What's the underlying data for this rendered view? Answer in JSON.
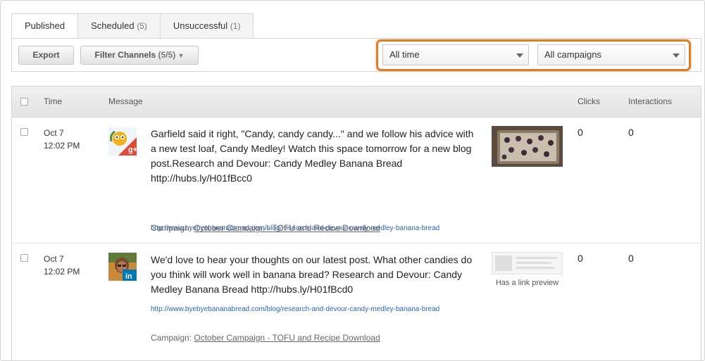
{
  "tabs": [
    {
      "label": "Published",
      "count": ""
    },
    {
      "label": "Scheduled",
      "count": "(5)"
    },
    {
      "label": "Unsuccessful",
      "count": "(1)"
    }
  ],
  "toolbar": {
    "export_label": "Export",
    "filter_label": "Filter Channels",
    "filter_count": "(5/5)",
    "time_select": "All time",
    "campaign_select": "All campaigns"
  },
  "table": {
    "headers": {
      "time": "Time",
      "message": "Message",
      "clicks": "Clicks",
      "interactions": "Interactions"
    },
    "rows": [
      {
        "date": "Oct 7",
        "time": "12:02 PM",
        "network": "google-plus",
        "message": "Garfield said it right, \"Candy, candy candy...\" and we follow his advice with a new test loaf, Candy Medley! Watch this space tomorrow for a new blog post.Research and Devour: Candy Medley Banana Bread http://hubs.ly/H01fBcc0",
        "link": "http://www.byebyebananabread.com/blog/research-and-devour-candy-medley-banana-bread",
        "campaign_label": "Campaign:",
        "campaign": "October Campaign - TOFU and Recipe Download",
        "clicks": "0",
        "interactions": "0"
      },
      {
        "date": "Oct 7",
        "time": "12:02 PM",
        "network": "linkedin",
        "message": "We'd love to hear your thoughts on our latest post. What other candies do you think will work well in banana bread? Research and Devour: Candy Medley Banana Bread http://hubs.ly/H01fBcd0",
        "link": "http://www.byebyebananabread.com/blog/research-and-devour-candy-medley-banana-bread",
        "campaign_label": "Campaign:",
        "campaign": "October Campaign - TOFU and Recipe Download",
        "preview_label": "Has a link preview",
        "clicks": "0",
        "interactions": "0"
      }
    ]
  },
  "colors": {
    "highlight": "#e07b28",
    "link": "#2a65b3",
    "gplus": "#dd4b39",
    "linkedin": "#0077b5"
  },
  "icons": [
    "caret-down-icon",
    "google-plus-icon",
    "linkedin-icon",
    "checkbox"
  ]
}
